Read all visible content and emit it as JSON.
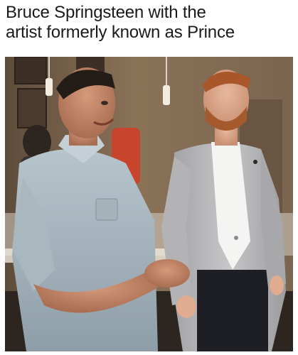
{
  "caption": {
    "line1": "Bruce Springsteen with the",
    "line2": "artist formerly known as Prince"
  },
  "photo": {
    "subject_left": "man in light denim shirt, smiling, hands clasped",
    "subject_right": "man with red beard in light grey blazer and white shirt"
  }
}
